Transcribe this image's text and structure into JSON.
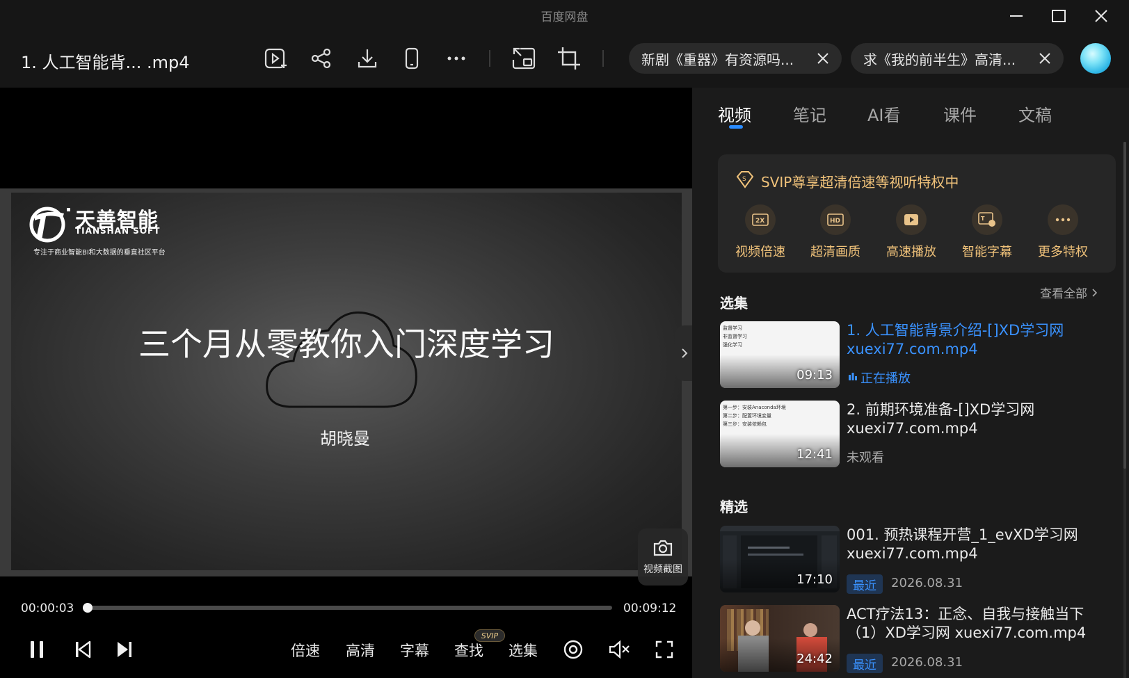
{
  "window": {
    "app_title": "百度网盘"
  },
  "toolbar": {
    "file_title": "1. 人工智能背...  .mp4",
    "tabs": [
      {
        "label": "新剧《重器》有资源吗..."
      },
      {
        "label": "求《我的前半生》高清..."
      }
    ]
  },
  "slide": {
    "logo_cn": "天善智能",
    "logo_en": "TIANSHAN SOFT",
    "logo_tagline": "专注于商业智能BI和大数据的垂直社区平台",
    "title": "三个月从零教你入门深度学习",
    "author": "胡晓曼"
  },
  "player": {
    "snapshot_label": "视频截图",
    "current_time": "00:00:03",
    "total_time": "00:09:12",
    "progress_fraction": 0.005,
    "controls": {
      "speed": "倍速",
      "quality": "高清",
      "subtitle": "字幕",
      "search": "查找",
      "search_badge": "SVIP",
      "episodes": "选集"
    }
  },
  "panel": {
    "tabs": [
      {
        "label": "视频",
        "active": true
      },
      {
        "label": "笔记"
      },
      {
        "label": "AI看"
      },
      {
        "label": "课件"
      },
      {
        "label": "文稿"
      }
    ],
    "svip": {
      "title": "SVIP尊享超清倍速等视听特权中",
      "perks": [
        {
          "label": "视频倍速",
          "icon": "speed-2x-icon"
        },
        {
          "label": "超清画质",
          "icon": "hd-icon"
        },
        {
          "label": "高速播放",
          "icon": "fast-play-icon"
        },
        {
          "label": "智能字幕",
          "icon": "smart-subtitle-icon"
        },
        {
          "label": "更多特权",
          "icon": "more-icon"
        }
      ]
    },
    "episodes": {
      "title": "选集",
      "view_all": "查看全部",
      "items": [
        {
          "title": "1. 人工智能背景介绍-[]XD学习网 xuexi77.com.mp4",
          "duration": "09:13",
          "status": "正在播放",
          "thumb_text": "监督学习\n非监督学习\n强化学习"
        },
        {
          "title": "2. 前期环境准备-[]XD学习网 xuexi77.com.mp4",
          "duration": "12:41",
          "status": "未观看",
          "thumb_text": "第一步：安装Anaconda环境\n第二步：配置环境变量\n第三步：安装依赖包"
        }
      ]
    },
    "featured": {
      "title": "精选",
      "items": [
        {
          "title": "001. 预热课程开营_1_evXD学习网 xuexi77.com.mp4",
          "duration": "17:10",
          "badge": "最近",
          "date": "2026.08.31"
        },
        {
          "title": "ACT疗法13：正念、自我与接触当下（1）XD学习网 xuexi77.com.mp4",
          "duration": "24:42",
          "badge": "最近",
          "date": "2026.08.31"
        }
      ]
    }
  }
}
